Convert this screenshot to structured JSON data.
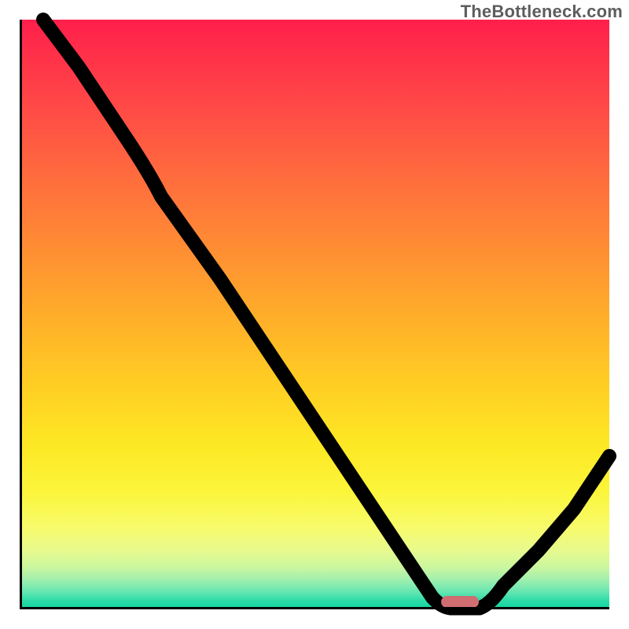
{
  "watermark": "TheBottleneck.com",
  "chart_data": {
    "type": "line",
    "title": "",
    "xlabel": "",
    "ylabel": "",
    "xlim": [
      0,
      100
    ],
    "ylim": [
      0,
      100
    ],
    "series": [
      {
        "name": "curve",
        "x": [
          4,
          10,
          18,
          22,
          26,
          34,
          42,
          50,
          58,
          64,
          68,
          70,
          72,
          74,
          78,
          82,
          88,
          94,
          100
        ],
        "values": [
          100,
          92,
          80,
          74,
          68,
          56,
          44,
          32,
          20,
          11,
          5,
          2,
          0.5,
          0,
          0,
          4,
          10,
          17,
          26
        ]
      }
    ],
    "colors": {
      "top": "#ff1f4b",
      "bottom": "#0fd49e",
      "marker": "#cf6d71"
    },
    "marker": {
      "x": 74,
      "y": 0,
      "width_pct": 6
    }
  }
}
